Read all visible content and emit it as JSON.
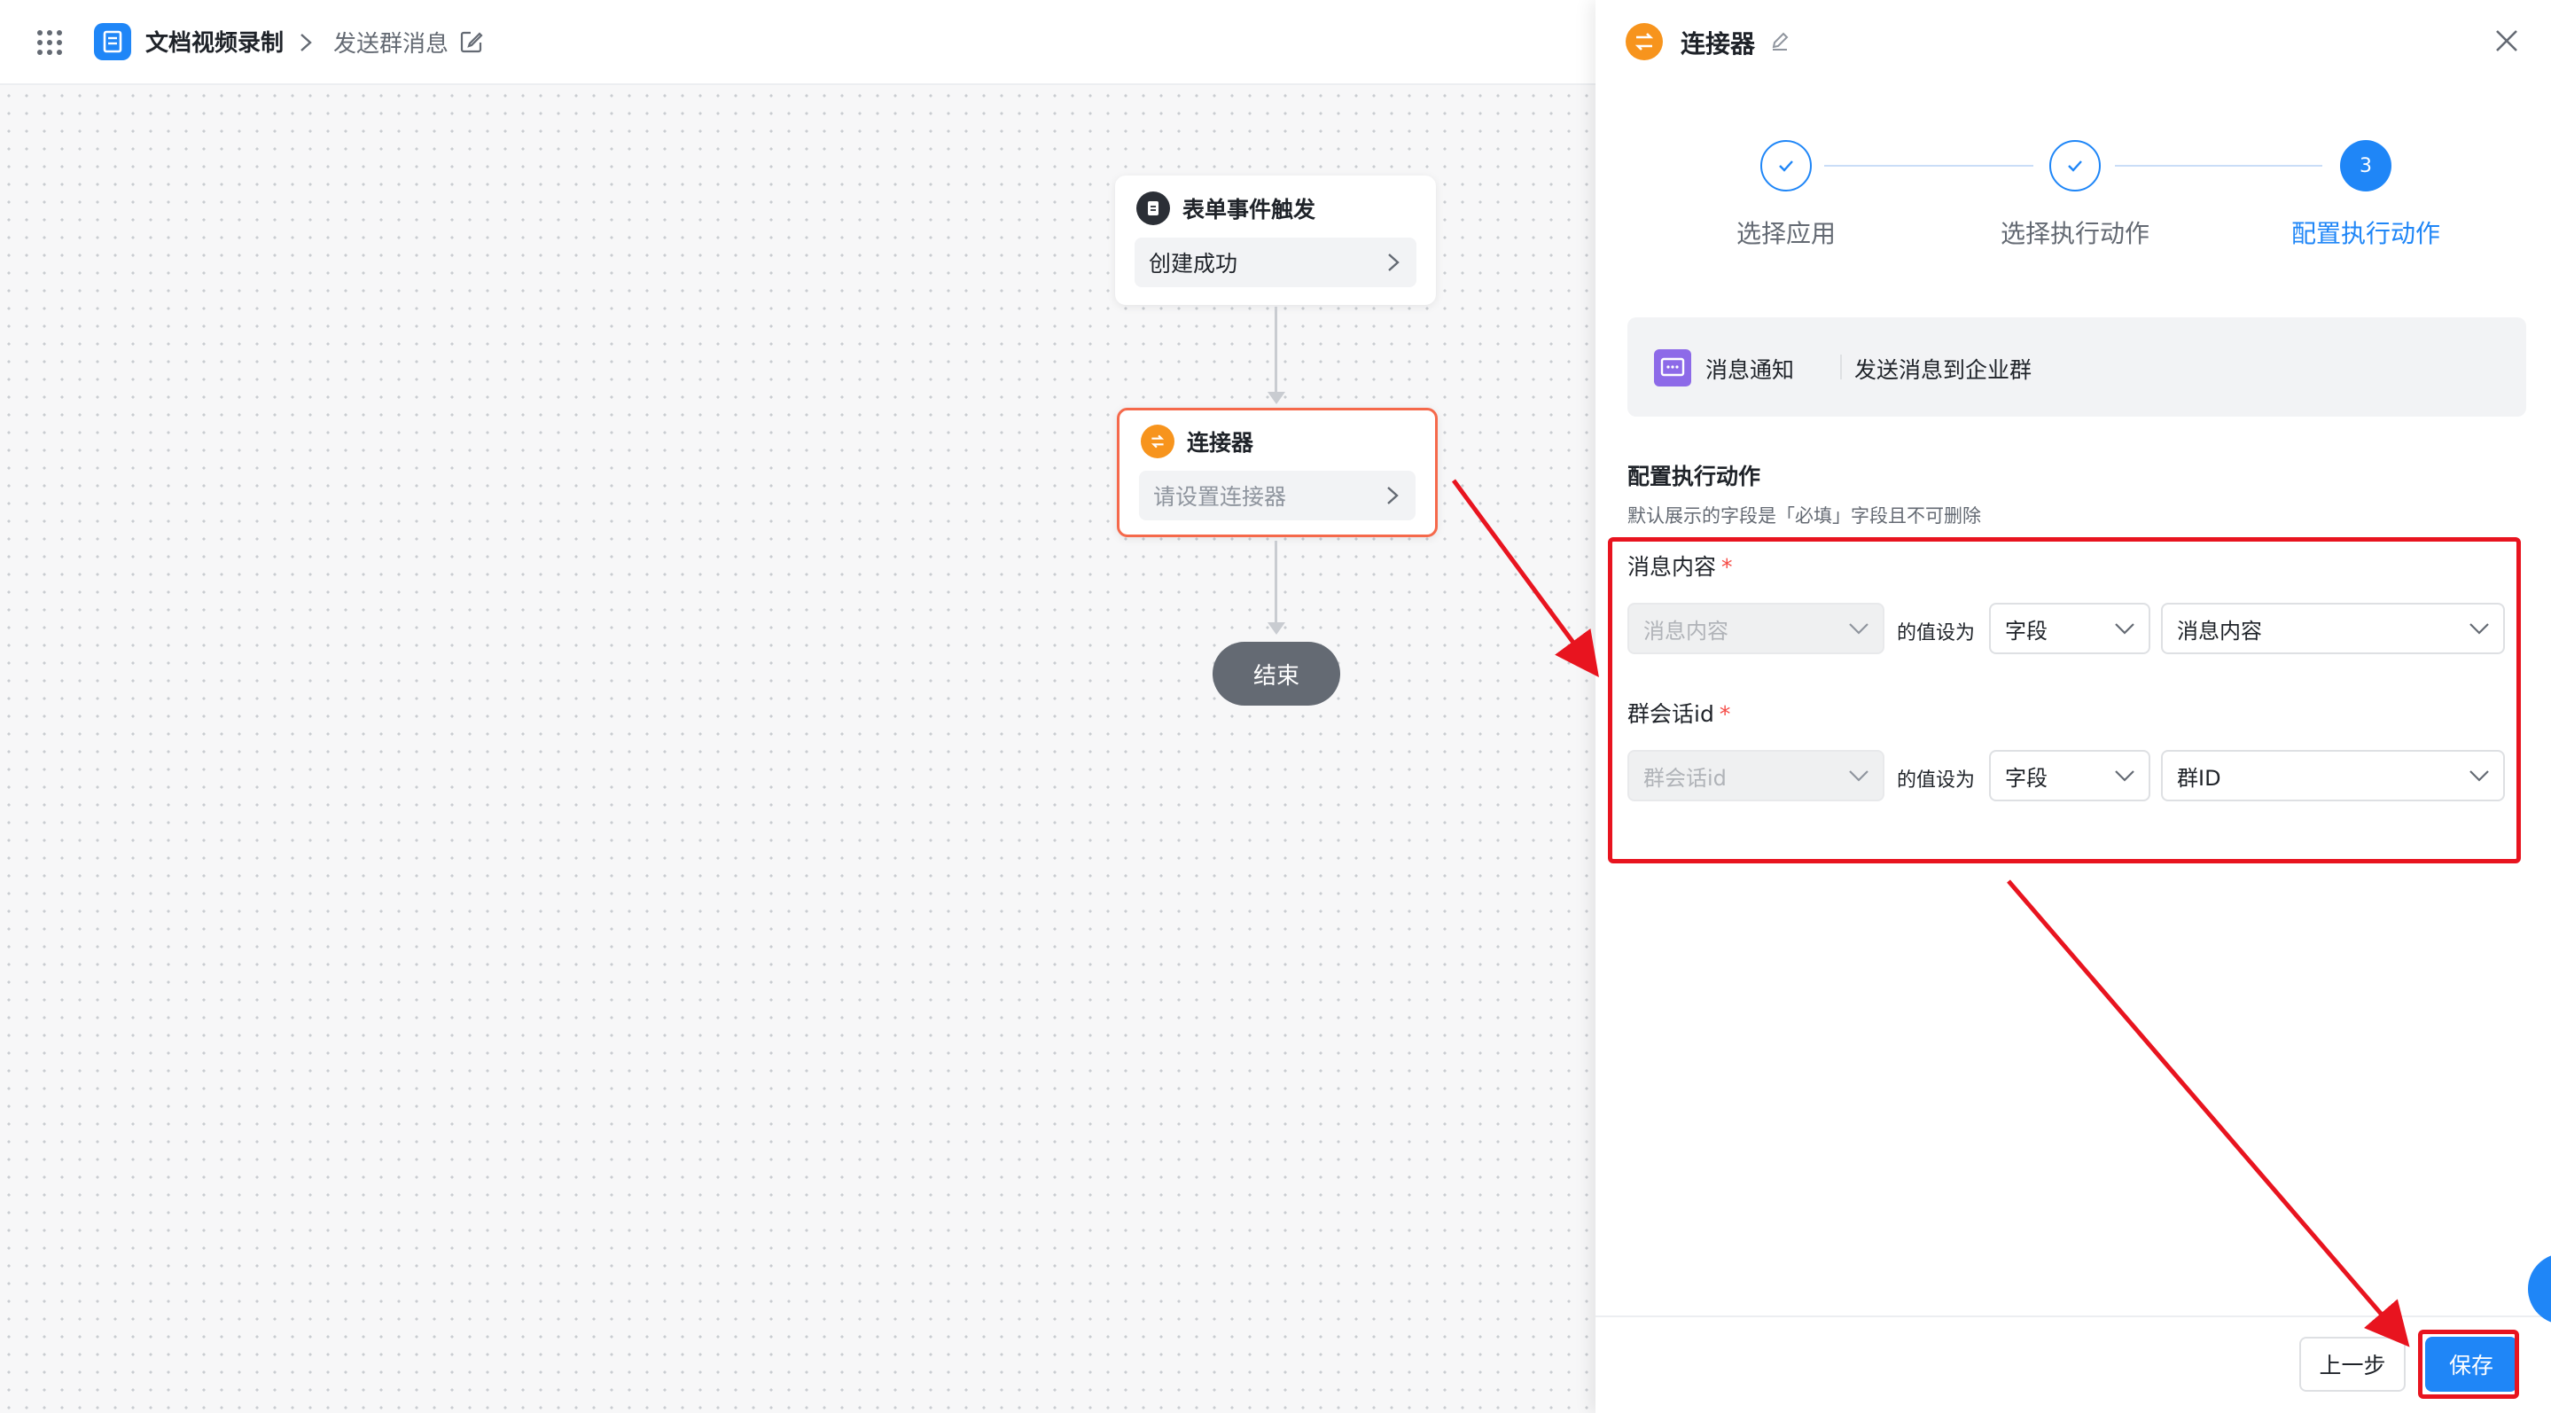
{
  "topbar": {
    "app_name": "文档视频录制",
    "breadcrumb_current": "发送群消息",
    "icons": [
      "apps-grid-icon",
      "app-logo-icon",
      "chevron-right-icon",
      "edit-icon"
    ]
  },
  "canvas": {
    "trigger_node": {
      "title": "表单事件触发",
      "value": "创建成功"
    },
    "connector_node": {
      "title": "连接器",
      "placeholder": "请设置连接器"
    },
    "end_node": {
      "label": "结束"
    }
  },
  "panel": {
    "title": "连接器",
    "steps": [
      {
        "label": "选择应用",
        "state": "done"
      },
      {
        "label": "选择执行动作",
        "state": "done"
      },
      {
        "label": "配置执行动作",
        "state": "active",
        "number": "3"
      }
    ],
    "action": {
      "app": "消息通知",
      "name": "发送消息到企业群"
    },
    "section": {
      "title": "配置执行动作",
      "desc": "默认展示的字段是「必填」字段且不可删除"
    },
    "fields": [
      {
        "label": "消息内容",
        "required_mark": "*",
        "target": "消息内容",
        "assign_text": "的值设为",
        "source_type": "字段",
        "source_value": "消息内容"
      },
      {
        "label": "群会话id",
        "required_mark": "*",
        "target": "群会话id",
        "assign_text": "的值设为",
        "source_type": "字段",
        "source_value": "群ID"
      }
    ],
    "footer": {
      "prev": "上一步",
      "save": "保存"
    }
  },
  "colors": {
    "primary": "#1f86f7",
    "connector_border": "#f5694b",
    "annotation": "#e8141f",
    "required": "#f54a45"
  }
}
